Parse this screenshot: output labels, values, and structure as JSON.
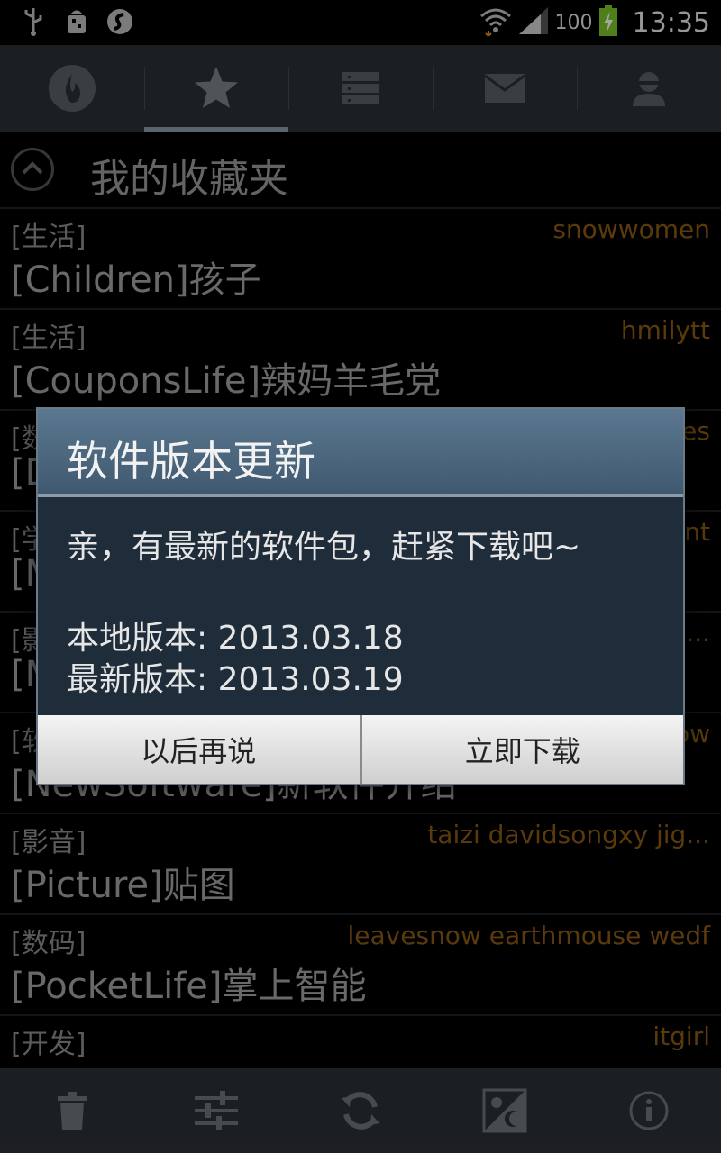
{
  "status_bar": {
    "battery": "100",
    "time": "13:35",
    "icons": [
      "usb-icon",
      "android-debug-icon",
      "sync-icon",
      "wifi-icon",
      "signal-icon",
      "battery-charging-icon"
    ]
  },
  "tabs": [
    {
      "icon": "fire-icon"
    },
    {
      "icon": "star-icon",
      "active": true
    },
    {
      "icon": "list-icon"
    },
    {
      "icon": "mail-icon"
    },
    {
      "icon": "user-icon"
    }
  ],
  "section": {
    "title": "我的收藏夹"
  },
  "items": [
    {
      "category": "[生活]",
      "users": "snowwomen",
      "title": "[Children]孩子"
    },
    {
      "category": "[生活]",
      "users": "hmilytt",
      "title": "[CouponsLife]辣妈羊毛党"
    },
    {
      "category": "[数",
      "users": "es",
      "title": "[Di"
    },
    {
      "category": "[学",
      "users": "nt",
      "title": "[M"
    },
    {
      "category": "[影",
      "users": "...",
      "title": "[M"
    },
    {
      "category": "[软",
      "users": "ow",
      "title": "[NewSoftware]新软件介绍"
    },
    {
      "category": "[影音]",
      "users": "taizi davidsongxy jig...",
      "title": "[Picture]贴图"
    },
    {
      "category": "[数码]",
      "users": "leavesnow earthmouse wedf",
      "title": "[PocketLife]掌上智能"
    },
    {
      "category": "[开发]",
      "users": "itgirl",
      "title": ""
    }
  ],
  "dialog": {
    "title": "软件版本更新",
    "message": "亲，有最新的软件包，赶紧下载吧~",
    "local_version": "本地版本: 2013.03.18",
    "latest_version": "最新版本: 2013.03.19",
    "later_label": "以后再说",
    "download_label": "立即下载"
  },
  "bottom_bar": [
    "trash-icon",
    "settings-sliders-icon",
    "refresh-icon",
    "day-night-icon",
    "info-icon"
  ],
  "colors": {
    "accent_user": "#8a5a12",
    "tab_bar": "#2c3034",
    "dialog_header": "#4a657c",
    "dialog_body": "#1f2c3a"
  }
}
